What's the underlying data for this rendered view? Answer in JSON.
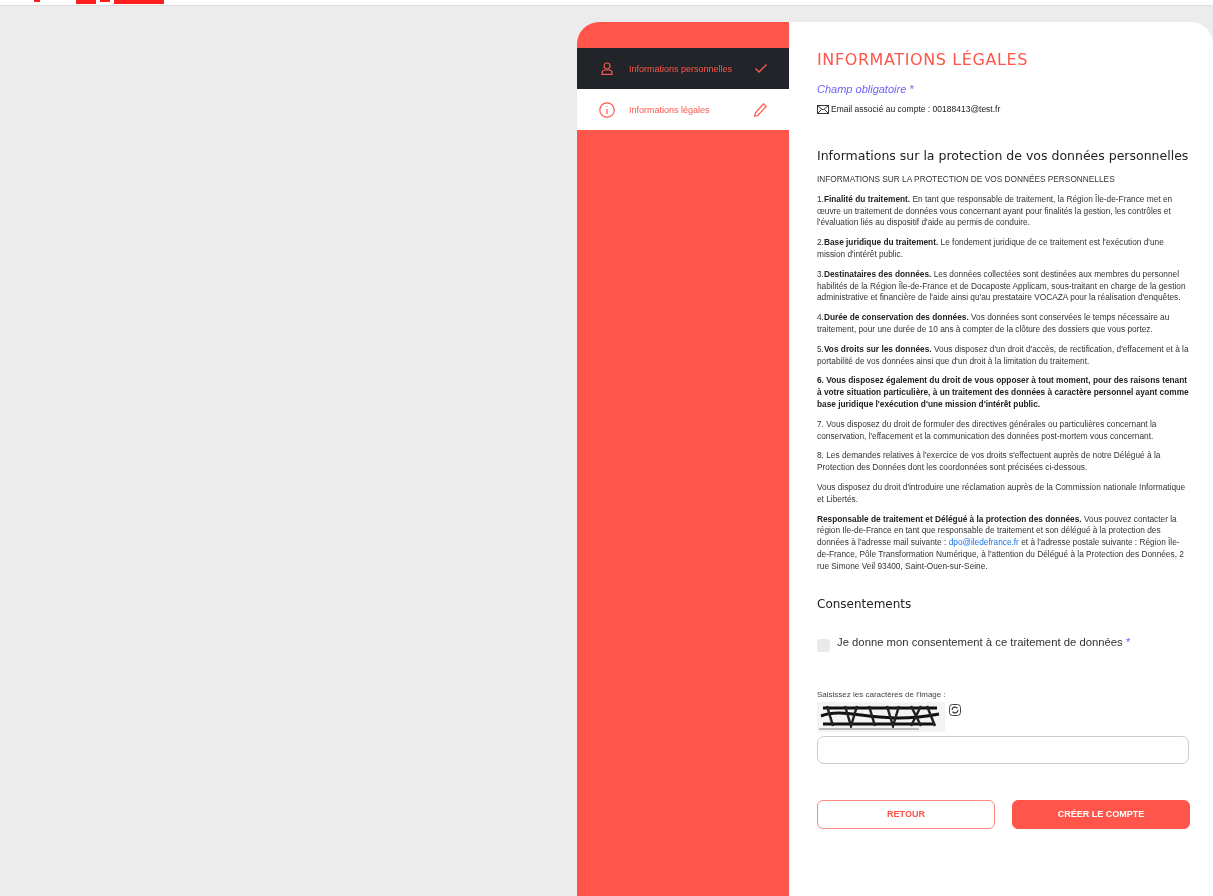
{
  "sidebar": {
    "items": [
      {
        "label": "Informations personnelles",
        "kind": "done",
        "selected": false
      },
      {
        "label": "Informations légales",
        "kind": "current",
        "selected": true
      }
    ]
  },
  "content": {
    "title": "INFORMATIONS LÉGALES",
    "required_note": "Champ obligatoire *",
    "email_line": "Email associé au compte : 00188413@test.fr",
    "privacy": {
      "heading": "Informations sur la protection de vos données personnelles",
      "subheading": "INFORMATIONS SUR LA PROTECTION DE VOS DONNÉES PERSONNELLES",
      "paragraphs": [
        {
          "text": "1.**Finalité du traitement.** En tant que responsable de traitement, la Région Île-de-France met en œuvre un traitement de données vous concernant ayant pour finalités la gestion, les contrôles et l'évaluation liés au dispositif d'aide au permis de conduire.",
          "bold": false
        },
        {
          "text": "2.**Base juridique du traitement.** Le fondement juridique de ce traitement est l'exécution d'une mission d'intérêt public.",
          "bold": false
        },
        {
          "text": "3.**Destinataires des données.** Les données collectées sont destinées aux membres du personnel habilités de la Région Île-de-France et de Docaposte Applicam, sous-traitant en charge de la gestion administrative et financière de l'aide ainsi qu'au prestataire VOCAZA pour la réalisation d'enquêtes.",
          "bold": false
        },
        {
          "text": "4.**Durée de conservation des données.** Vos données sont conservées le temps nécessaire au traitement, pour une durée de 10 ans à compter de la clôture des dossiers que vous portez.",
          "bold": false
        },
        {
          "text": "5.**Vos droits sur les données.** Vous disposez d'un droit d'accès, de rectification, d'effacement et à la portabilité de vos données ainsi que d'un droit à la limitation du traitement.",
          "bold": false
        },
        {
          "text": "6. Vous disposez également du droit de vous opposer à tout moment, pour des raisons tenant à votre situation particulière, à un traitement des données à caractère personnel ayant comme base juridique l'exécution d'une mission d'intérêt public.",
          "bold": true
        },
        {
          "text": "7. Vous disposez du droit de formuler des directives générales ou particulières concernant la conservation, l'effacement et la communication des données post-mortem vous concernant.",
          "bold": false
        },
        {
          "text": "8. Les demandes relatives à l'exercice de vos droits s'effectuent auprès de notre Délégué à la Protection des Données dont les coordonnées sont précisées ci-dessous.",
          "bold": false
        },
        {
          "text": "Vous disposez du droit d'introduire une réclamation auprès de la Commission nationale Informatique et Libertés.",
          "bold": false
        }
      ],
      "contact": {
        "before": "**Responsable de traitement et Délégué à la protection des données.** Vous pouvez contacter la région Ile-de-France en tant que responsable de traitement et son délégué à la protection des données à l'adresse mail suivante : ",
        "link": "dpo@iledefrance.fr",
        "after": " et à l'adresse postale suivante : Région Île-de-France, Pôle Transformation Numérique, à l'attention du Délégué à la Protection des Données, 2 rue Simone Veil 93400, Saint-Ouen-sur-Seine."
      }
    },
    "consent": {
      "heading": "Consentements",
      "label": "Je donne mon consentement à ce traitement de données",
      "required_mark": "*",
      "checked": false
    },
    "captcha": {
      "label": "Saisissez les caractères de l'image :"
    },
    "buttons": [
      {
        "label": "RETOUR",
        "kind": "secondary"
      },
      {
        "label": "CRÉER LE COMPTE",
        "kind": "primary"
      }
    ]
  }
}
